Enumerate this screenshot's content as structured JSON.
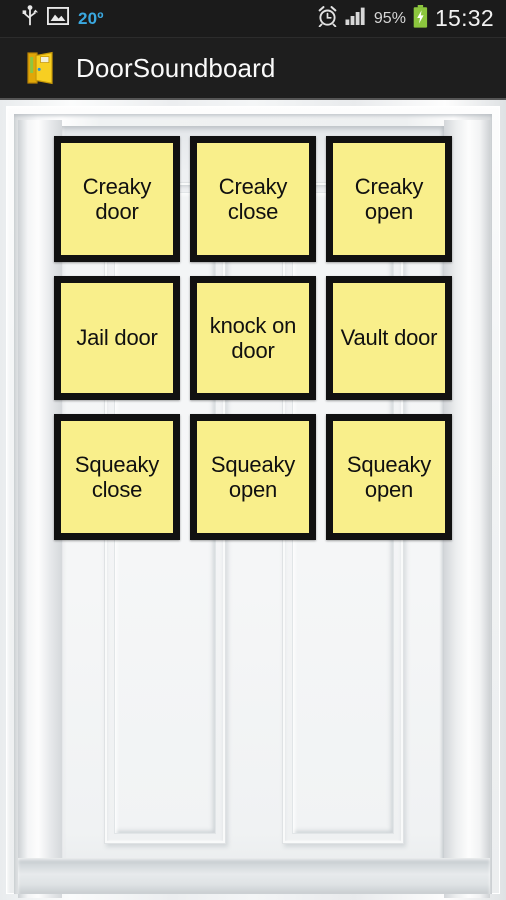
{
  "status_bar": {
    "usb_icon": "usb-icon",
    "image_icon": "image-icon",
    "temperature": "20º",
    "alarm_icon": "alarm-clock-icon",
    "signal_icon": "signal-bars-icon",
    "battery_percent": "95%",
    "battery_icon": "battery-charging-icon",
    "clock": "15:32",
    "accent_color": "#3aa8e0",
    "battery_color": "#8cc63e",
    "background_color": "#1b1b1b"
  },
  "title_bar": {
    "app_icon": "door-icon",
    "title": "DoorSoundboard",
    "background_color": "#1e1e1e",
    "text_color": "#fafafa"
  },
  "background": {
    "name": "white-panel-door-image",
    "description": "white two-panel interior door with moulded frame"
  },
  "button_grid": {
    "button_color": "#f9ef8b",
    "button_border_color": "#111111",
    "button_text_color": "#101010",
    "rows": [
      {
        "row_name": "creaky-row",
        "buttons": [
          {
            "name": "creaky-door-button",
            "label": "Creaky\ndoor"
          },
          {
            "name": "creaky-close-button",
            "label": "Creaky\nclose"
          },
          {
            "name": "creaky-open-button",
            "label": "Creaky\nopen"
          }
        ]
      },
      {
        "row_name": "jail-knock-vault-row",
        "buttons": [
          {
            "name": "jail-door-button",
            "label": "Jail door"
          },
          {
            "name": "knock-on-door-button",
            "label": "knock on\ndoor"
          },
          {
            "name": "vault-door-button",
            "label": "Vault door"
          }
        ]
      },
      {
        "row_name": "squeaky-row",
        "buttons": [
          {
            "name": "squeaky-close-button",
            "label": "Squeaky\nclose"
          },
          {
            "name": "squeaky-open-button",
            "label": "Squeaky\nopen"
          },
          {
            "name": "squeaky-open-button-alt",
            "label": "Squeaky\nopen"
          }
        ]
      }
    ]
  }
}
